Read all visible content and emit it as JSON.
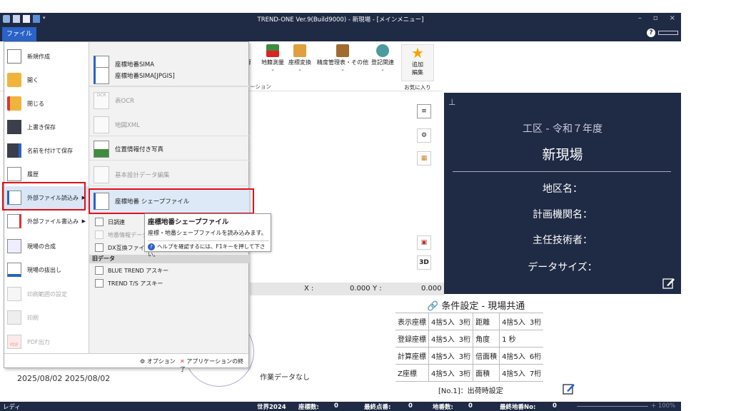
{
  "window": {
    "title": "TREND-ONE Ver.9(Build9000) - 新現場 - [メインメニュー]",
    "file_tab": "ファイル",
    "minimize": "–",
    "restore": "▫",
    "close": "×",
    "help": "?"
  },
  "ribbon": {
    "buttons": [
      {
        "label": "計算"
      },
      {
        "label": "地籍測量"
      },
      {
        "label": "座標変換"
      },
      {
        "label": "精度管理表・その他"
      },
      {
        "label": "登記関連"
      }
    ],
    "group_label": "ーション",
    "favorites": {
      "label_line1": "追加",
      "label_line2": "編集",
      "group": "お気に入り"
    }
  },
  "file_menu": {
    "items": [
      {
        "label": "新規作成"
      },
      {
        "label": "開く"
      },
      {
        "label": "閉じる"
      },
      {
        "label": "上書き保存"
      },
      {
        "label": "名前を付けて保存"
      },
      {
        "label": "履歴"
      },
      {
        "label": "外部ファイル読込み"
      },
      {
        "label": "外部ファイル書込み"
      },
      {
        "label": "現場の合成"
      },
      {
        "label": "現場の抜出し"
      },
      {
        "label": "印刷範囲の設定"
      },
      {
        "label": "印刷"
      },
      {
        "label": "PDF出力"
      }
    ],
    "submenu": [
      {
        "label": "座標地番SIMA"
      },
      {
        "label": "座標地番SIMA[JPGIS]"
      },
      {
        "label": "表OCR"
      },
      {
        "label": "地図XML"
      },
      {
        "label": "位置情報付き写真"
      },
      {
        "label": "基本設計データ編集"
      },
      {
        "label": "座標地番 シェープファイル"
      }
    ],
    "small_items": [
      {
        "label": "日調連"
      },
      {
        "label": "地番情報データ"
      },
      {
        "label": "DX互換ファイル"
      }
    ],
    "old_header": "旧データ",
    "old_items": [
      {
        "label": "BLUE TREND アスキー"
      },
      {
        "label": "TREND T/S アスキー"
      }
    ],
    "options": "オプション",
    "quit": "アプリケーションの終了",
    "ocr_badge": "OCR",
    "pdf_badge": "PDF"
  },
  "tooltip": {
    "title": "座標地番シェープファイル",
    "desc": "座標・地番シェープファイルを読み込みます。",
    "help": "ヘルプを確認するには、F1キーを押して下さい。"
  },
  "panel": {
    "area": "工区 - 令和７年度",
    "site": "新現場",
    "labels": [
      "地区名：",
      "計画機関名：",
      "主任技術者：",
      "データサイズ："
    ]
  },
  "coords": {
    "x_label": "X :",
    "x_value": "0.000",
    "y_label": "Y :",
    "y_value": "0.000"
  },
  "conditions": {
    "title": "条件設定 - 現場共通",
    "rows": [
      {
        "k1": "表示座標",
        "v1a": "4捨5入",
        "v1b": "3桁",
        "k2": "距離",
        "v2a": "4捨5入",
        "v2b": "3桁"
      },
      {
        "k1": "登録座標",
        "v1a": "4捨5入",
        "v1b": "3桁",
        "k2": "角度",
        "v2a": "1 秒",
        "v2b": ""
      },
      {
        "k1": "計算座標",
        "v1a": "4捨5入",
        "v1b": "3桁",
        "k2": "倍面積",
        "v2a": "4捨5入",
        "v2b": "6桁"
      },
      {
        "k1": "Z座標",
        "v1a": "4捨5入",
        "v1b": "3桁",
        "k2": "面積",
        "v2a": "4捨5入",
        "v2b": "7桁"
      }
    ],
    "factory": "[No.1]：出荷時設定"
  },
  "misc": {
    "no_data": "作業データなし",
    "dates": "2025/08/02 2025/08/02",
    "sidebtn_3d": "3D"
  },
  "statusbar": {
    "ready": "レディ",
    "world": "世界2024",
    "coord_count_label": "座標数:",
    "coord_count": "0",
    "last_point_label": "最終点番:",
    "last_point": "0",
    "parcel_count_label": "地番数:",
    "parcel_count": "0",
    "last_parcel_label": "最終地番No:",
    "last_parcel": "0",
    "zoom": "+ 100%"
  }
}
